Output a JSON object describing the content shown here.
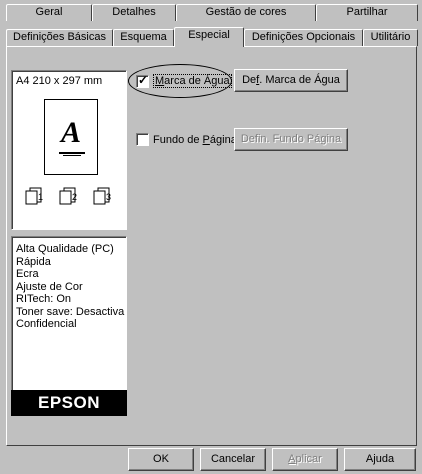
{
  "tabs_back": [
    {
      "label": "Geral"
    },
    {
      "label": "Detalhes"
    },
    {
      "label": "Gestão de cores"
    },
    {
      "label": "Partilhar"
    }
  ],
  "tabs_front": [
    {
      "label": "Definições Básicas"
    },
    {
      "label": "Esquema"
    },
    {
      "label": "Especial"
    },
    {
      "label": "Definições Opcionais"
    },
    {
      "label": "Utilitário"
    }
  ],
  "active_tab": "Especial",
  "preview": {
    "paper_size": "A4 210 x 297 mm",
    "glyph": "A",
    "copy_icons": [
      "1",
      "2",
      "3"
    ]
  },
  "settings_summary": [
    "Alta Qualidade (PC)",
    "Rápida",
    "Ecra",
    "Ajuste de Cor",
    "RITech: On",
    "Toner save: Desactiva",
    "Confidencial"
  ],
  "brand": "EPSON",
  "watermark": {
    "label_prefix": "",
    "label_accel": "M",
    "label_rest": "arca de Água",
    "checked": true,
    "button_prefix": "De",
    "button_accel": "f",
    "button_rest": ". Marca de Água"
  },
  "page_background": {
    "label_prefix": "Fundo de ",
    "label_accel": "P",
    "label_rest": "ágina",
    "checked": false,
    "button_label": "Defin. Fundo Página"
  },
  "footer": {
    "ok": "OK",
    "cancel": "Cancelar",
    "apply_accel": "A",
    "apply_rest": "plicar",
    "help": "Ajuda"
  }
}
